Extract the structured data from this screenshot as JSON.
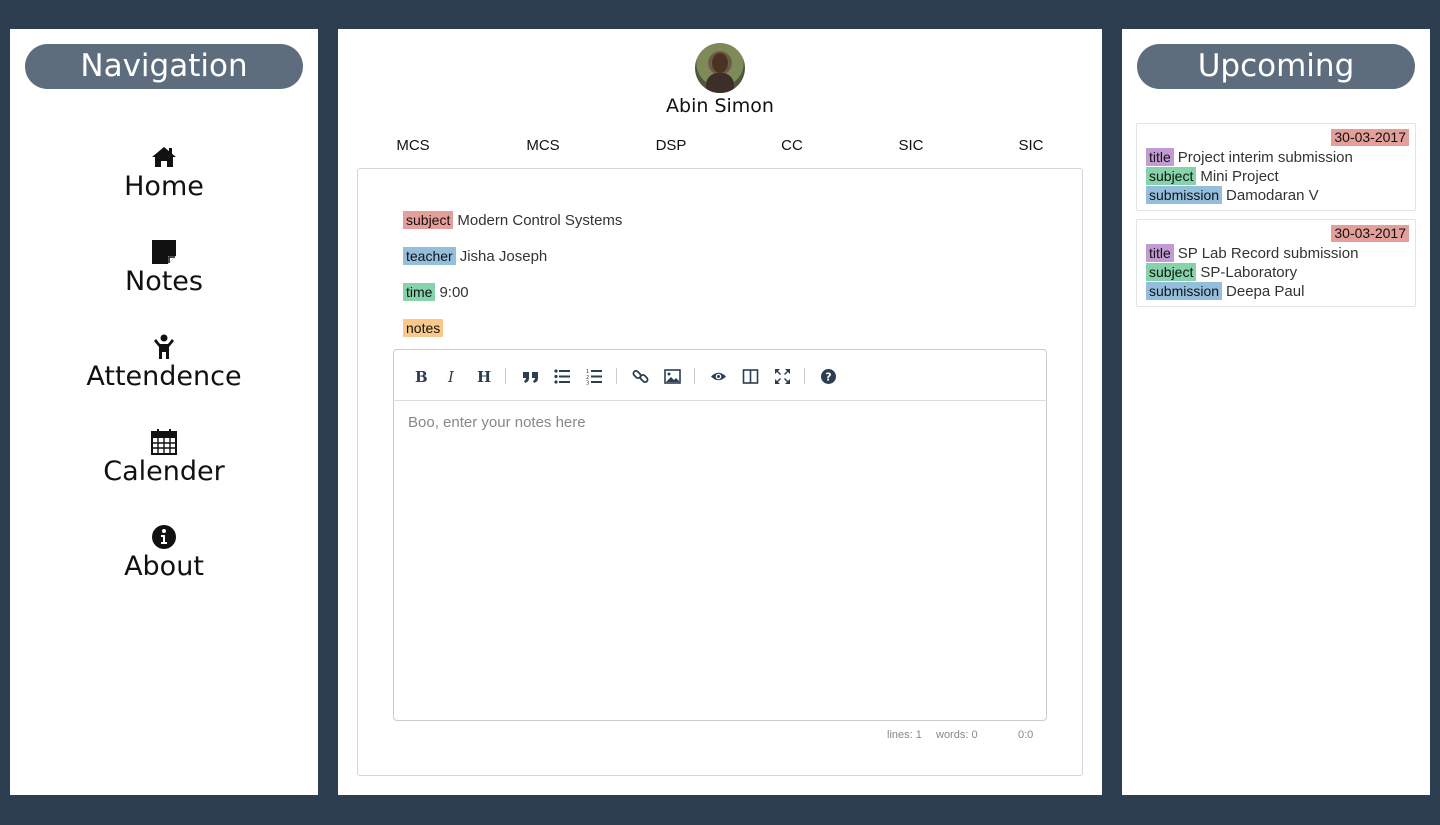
{
  "navigation": {
    "title": "Navigation",
    "items": [
      {
        "label": "Home",
        "icon": "home-icon"
      },
      {
        "label": "Notes",
        "icon": "sticky-note-icon"
      },
      {
        "label": "Attendence",
        "icon": "child-icon"
      },
      {
        "label": "Calender",
        "icon": "calendar-icon"
      },
      {
        "label": "About",
        "icon": "info-icon"
      }
    ]
  },
  "profile": {
    "name": "Abin Simon"
  },
  "tabs": [
    "MCS",
    "MCS",
    "DSP",
    "CC",
    "SIC",
    "SIC"
  ],
  "detail": {
    "subject_tag": "subject",
    "subject": "Modern Control Systems",
    "teacher_tag": "teacher",
    "teacher": "Jisha Joseph",
    "time_tag": "time",
    "time": "9:00",
    "notes_tag": "notes"
  },
  "editor": {
    "placeholder": "Boo, enter your notes here",
    "toolbar": [
      "bold-icon",
      "italic-icon",
      "heading-icon",
      "quote-icon",
      "unordered-list-icon",
      "ordered-list-icon",
      "link-icon",
      "image-icon",
      "preview-icon",
      "side-by-side-icon",
      "fullscreen-icon",
      "help-icon"
    ],
    "status": {
      "lines": "lines: 1",
      "words": "words: 0",
      "cursor": "0:0"
    }
  },
  "upcoming": {
    "title": "Upcoming",
    "items": [
      {
        "date": "30-03-2017",
        "title_tag": "title",
        "title": "Project interim submission",
        "subject_tag": "subject",
        "subject": "Mini Project",
        "submission_tag": "submission",
        "submission": "Damodaran V"
      },
      {
        "date": "30-03-2017",
        "title_tag": "title",
        "title": "SP Lab Record submission",
        "subject_tag": "subject",
        "subject": "SP-Laboratory",
        "submission_tag": "submission",
        "submission": "Deepa Paul"
      }
    ]
  },
  "colors": {
    "background": "#2c3e50",
    "pill": "#5d6d7e",
    "tag_red": "#e59f9b",
    "tag_blue": "#93bfdd",
    "tag_green": "#86d3ab",
    "tag_orange": "#f8c98a",
    "tag_purple": "#c39bd3"
  }
}
